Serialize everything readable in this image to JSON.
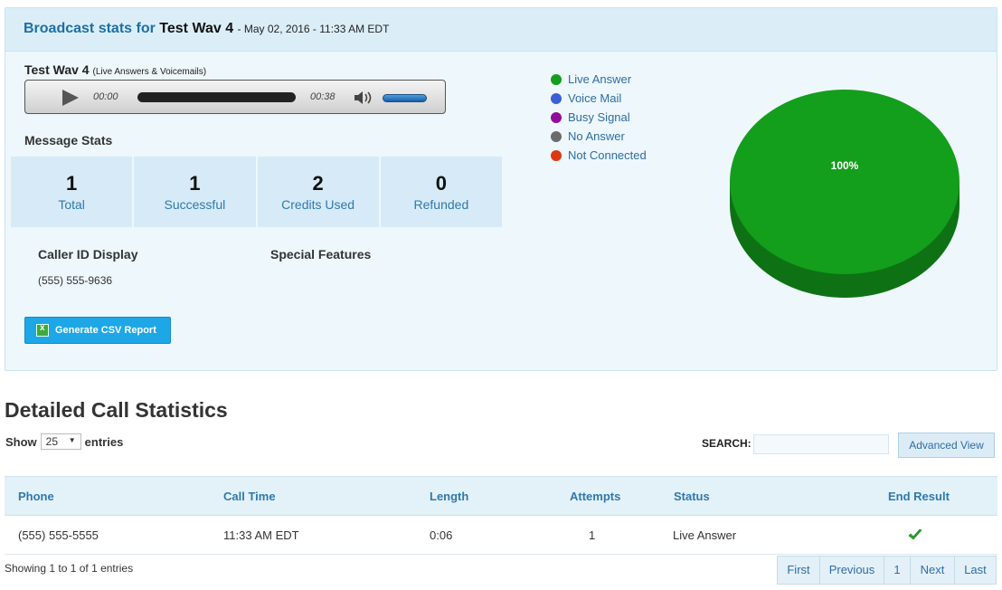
{
  "broadcast": {
    "heading_prefix": "Broadcast stats for",
    "name": "Test Wav 4",
    "date": "- May 02, 2016 - 11:33 AM EDT"
  },
  "recording": {
    "title": "Test Wav 4",
    "subtitle": "(Live Answers & Voicemails)",
    "current_time": "00:00",
    "duration": "00:38",
    "progress_fraction": 0.0,
    "volume_fraction": 1.0
  },
  "message_stats": {
    "heading": "Message Stats",
    "items": [
      {
        "value": "1",
        "label": "Total"
      },
      {
        "value": "1",
        "label": "Successful"
      },
      {
        "value": "2",
        "label": "Credits Used"
      },
      {
        "value": "0",
        "label": "Refunded"
      }
    ]
  },
  "caller_id": {
    "heading": "Caller ID Display",
    "value": "(555) 555-9636"
  },
  "special_features": {
    "heading": "Special Features"
  },
  "csv_button": {
    "label": "Generate CSV Report"
  },
  "legend": [
    {
      "label": "Live Answer",
      "color": "#139e1c"
    },
    {
      "label": "Voice Mail",
      "color": "#3a5fd6"
    },
    {
      "label": "Busy Signal",
      "color": "#8f0d9a"
    },
    {
      "label": "No Answer",
      "color": "#6b6b6b"
    },
    {
      "label": "Not Connected",
      "color": "#dc3912"
    }
  ],
  "chart_data": {
    "type": "pie",
    "categories": [
      "Live Answer"
    ],
    "values": [
      100
    ],
    "data_labels": [
      "100%"
    ],
    "colors": [
      "#139e1c"
    ],
    "three_d": true,
    "legend_position": "left"
  },
  "detailed": {
    "heading": "Detailed Call Statistics",
    "show_label": "Show",
    "entries_value": "25",
    "entries_label": "entries",
    "search_label": "SEARCH:",
    "search_value": "",
    "advanced_view": "Advanced View",
    "columns": [
      "Phone",
      "Call Time",
      "Length",
      "Attempts",
      "Status",
      "End Result"
    ],
    "rows": [
      {
        "phone": "(555) 555-5555",
        "call_time": "11:33 AM EDT",
        "length": "0:06",
        "attempts": "1",
        "status": "Live Answer",
        "end_result": "check-icon"
      }
    ],
    "showing": "Showing 1 to 1 of 1 entries",
    "pager": [
      "First",
      "Previous",
      "1",
      "Next",
      "Last"
    ]
  }
}
